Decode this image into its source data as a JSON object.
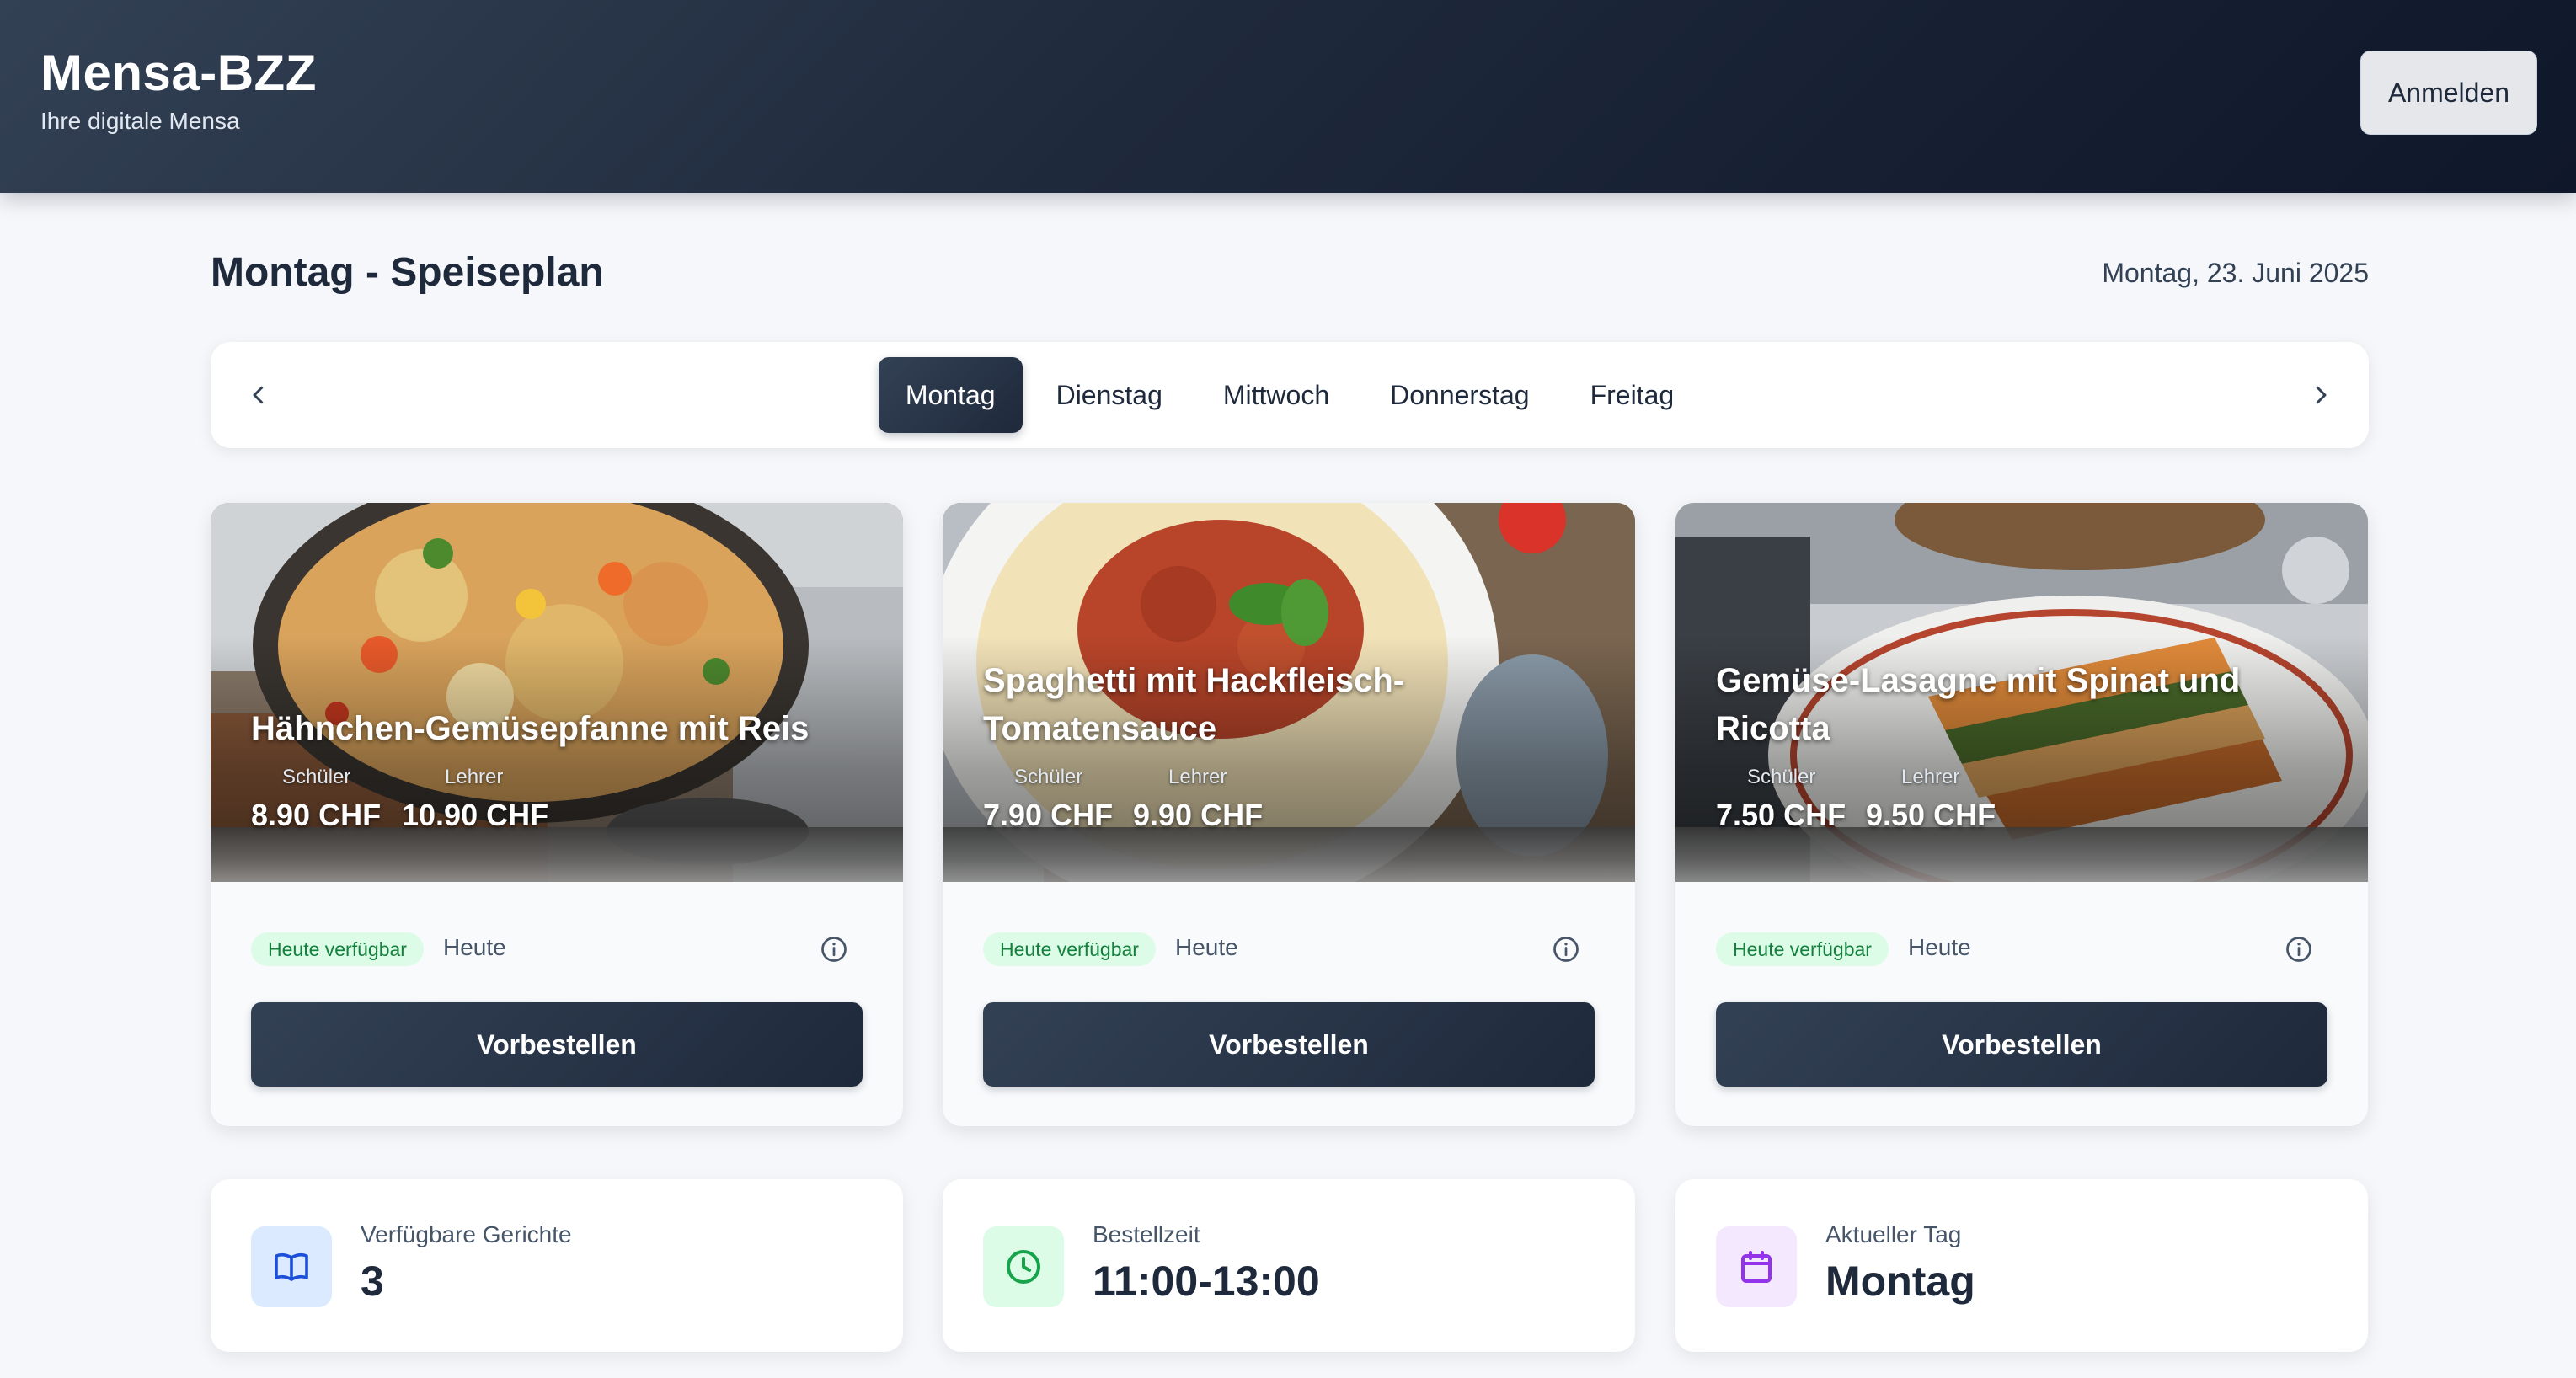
{
  "header": {
    "title": "Mensa-BZZ",
    "subtitle": "Ihre digitale Mensa",
    "login_label": "Anmelden"
  },
  "page": {
    "title": "Montag - Speiseplan",
    "date": "Montag, 23. Juni 2025"
  },
  "days": {
    "active": "Montag",
    "items": [
      "Montag",
      "Dienstag",
      "Mittwoch",
      "Donnerstag",
      "Freitag"
    ]
  },
  "meals": [
    {
      "name_lines": [
        "Hähnchen-Gemüsepfanne mit Reis"
      ],
      "student_label": "Schüler",
      "student_price": "8.90 CHF",
      "teacher_label": "Lehrer",
      "teacher_price": "10.90 CHF",
      "badge": "Heute verfügbar",
      "availability": "Heute",
      "order_label": "Vorbestellen"
    },
    {
      "name_lines": [
        "Spaghetti mit Hackfleisch-",
        "Tomatensauce"
      ],
      "student_label": "Schüler",
      "student_price": "7.90 CHF",
      "teacher_label": "Lehrer",
      "teacher_price": "9.90 CHF",
      "badge": "Heute verfügbar",
      "availability": "Heute",
      "order_label": "Vorbestellen"
    },
    {
      "name_lines": [
        "Gemüse-Lasagne mit Spinat und",
        "Ricotta"
      ],
      "student_label": "Schüler",
      "student_price": "7.50 CHF",
      "teacher_label": "Lehrer",
      "teacher_price": "9.50 CHF",
      "badge": "Heute verfügbar",
      "availability": "Heute",
      "order_label": "Vorbestellen"
    }
  ],
  "stats": {
    "dishes": {
      "label": "Verfügbare Gerichte",
      "value": "3",
      "icon": "book-icon"
    },
    "order_time": {
      "label": "Bestellzeit",
      "value": "11:00-13:00",
      "icon": "clock-icon"
    },
    "current_day": {
      "label": "Aktueller Tag",
      "value": "Montag",
      "icon": "calendar-icon"
    }
  },
  "colors": {
    "header_dark": "#1e293b",
    "badge_bg": "#dcfce7",
    "badge_text": "#15803d"
  }
}
